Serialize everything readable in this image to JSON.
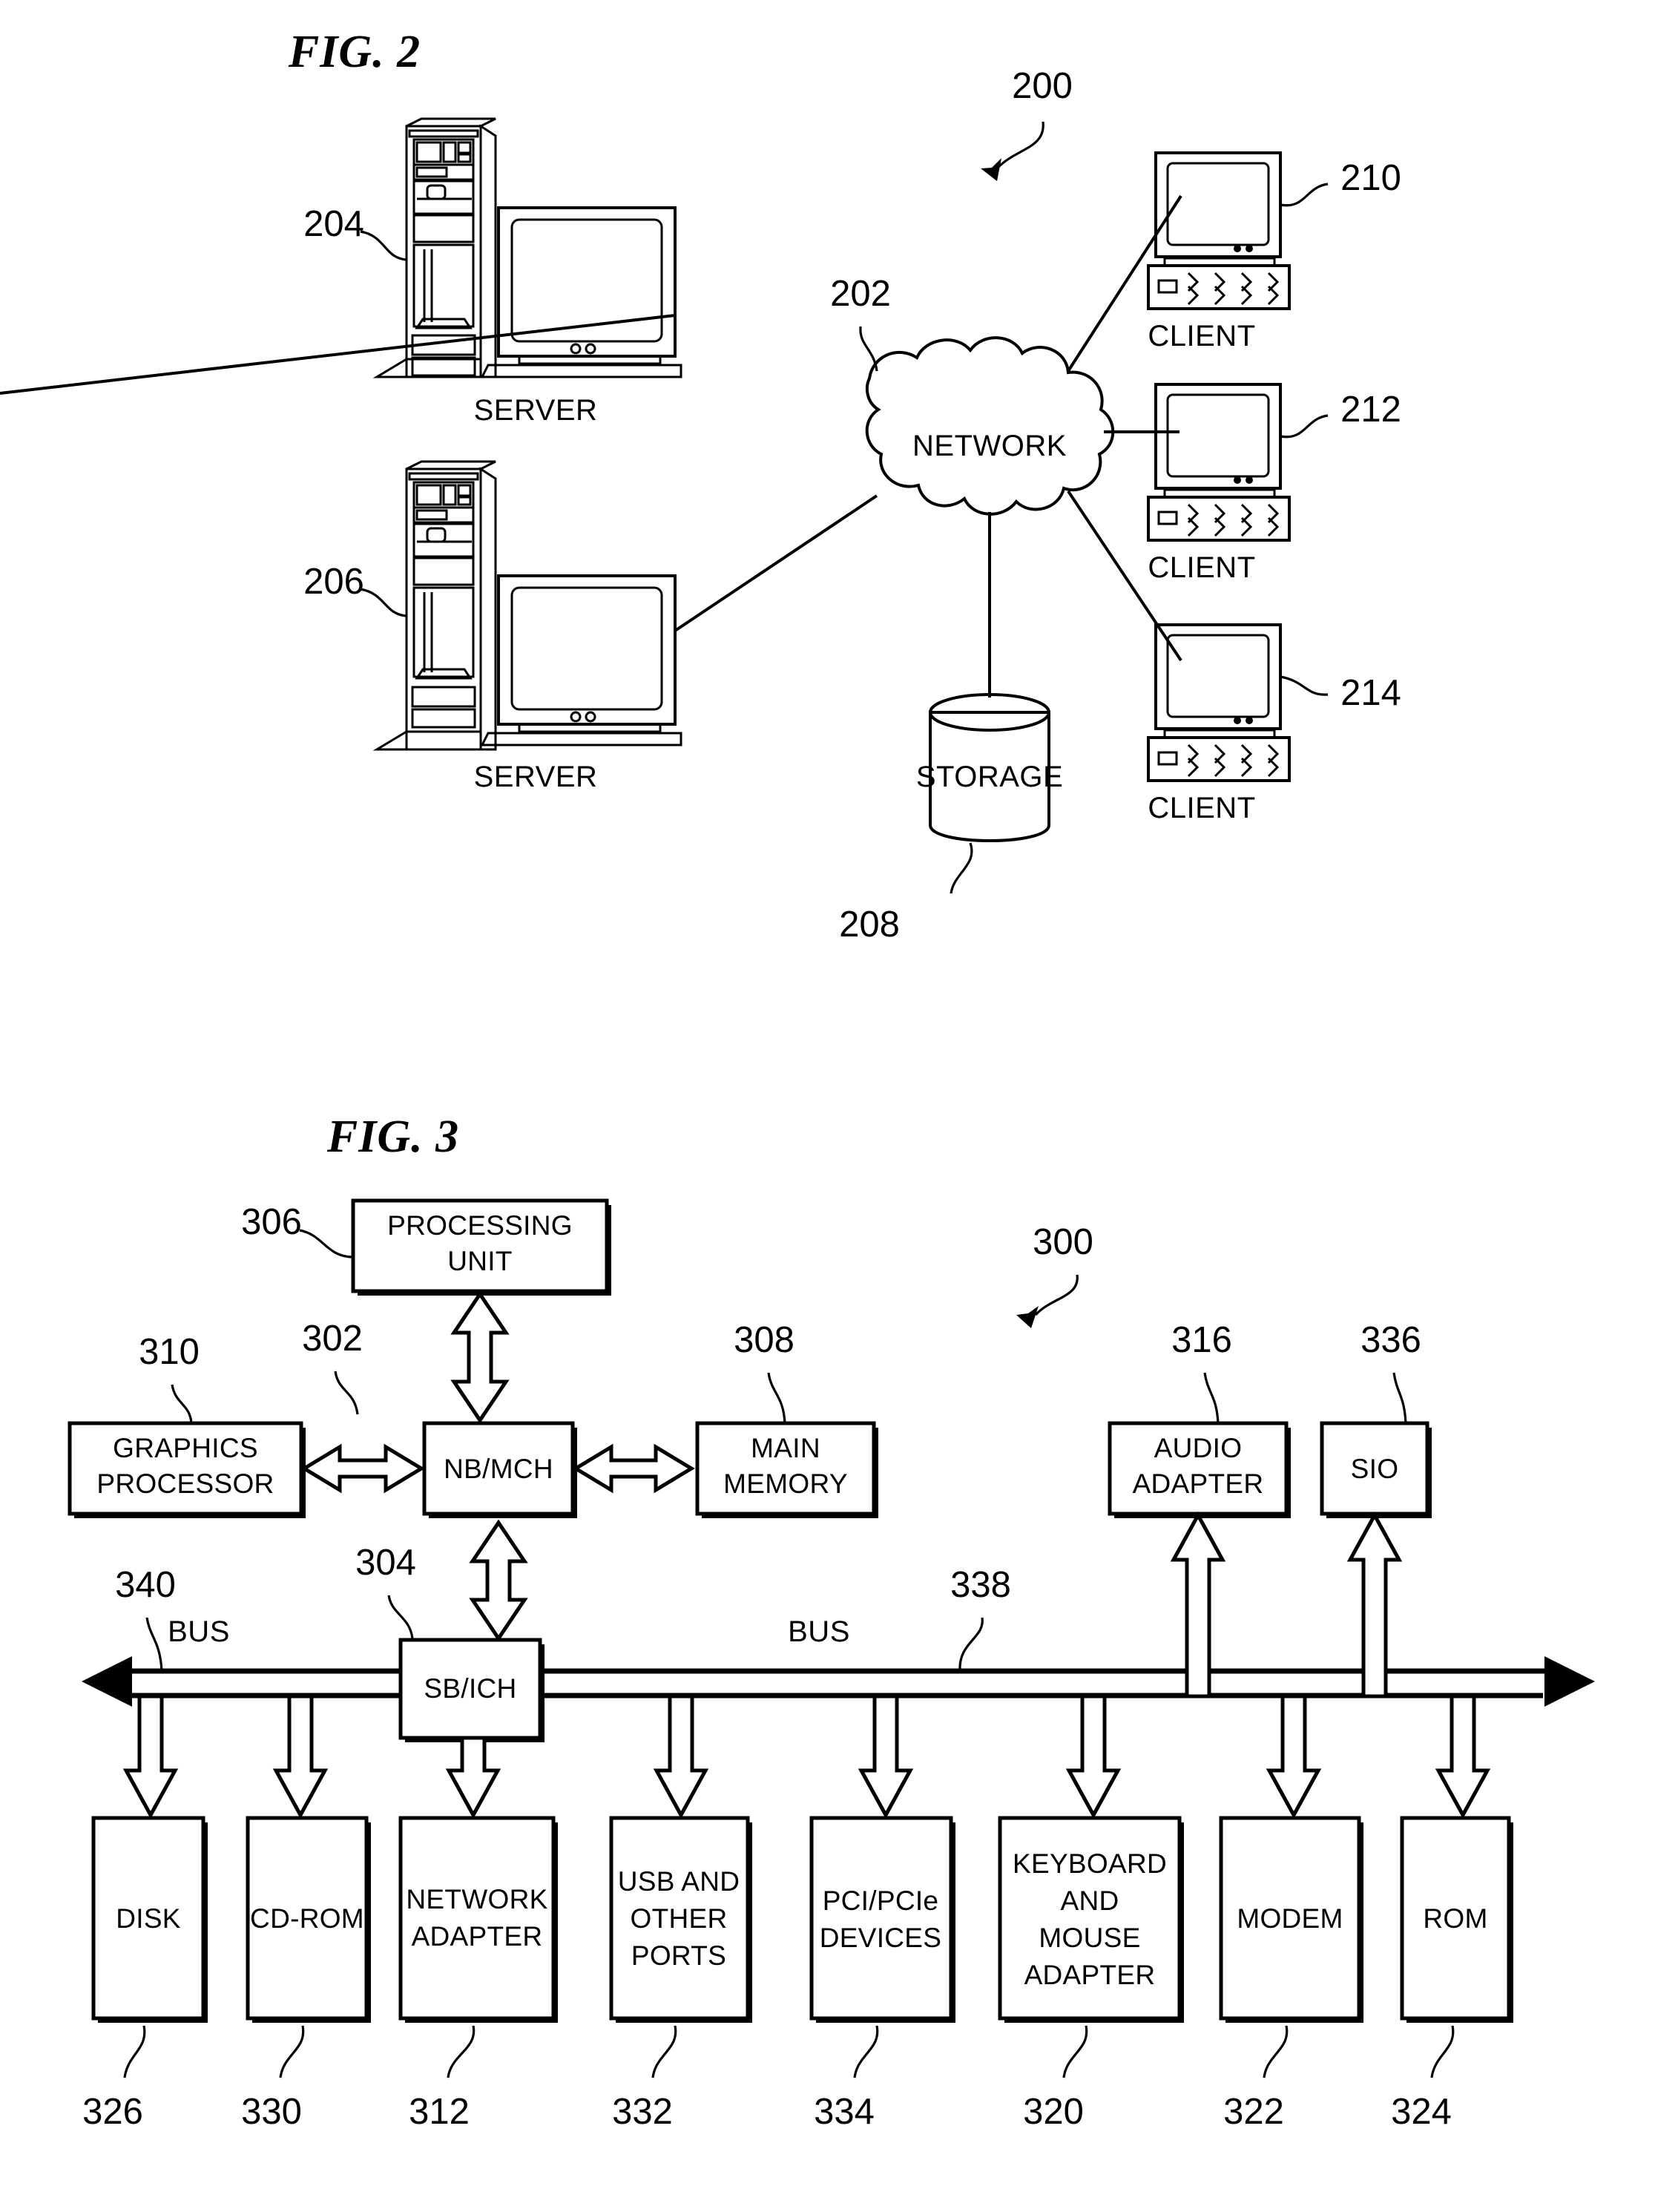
{
  "figures": [
    {
      "id": "fig2",
      "title": "FIG. 2",
      "system_ref": "200",
      "nodes": {
        "network": {
          "label": "NETWORK",
          "ref": "202"
        },
        "server_top": {
          "label": "SERVER",
          "ref": "204"
        },
        "server_bottom": {
          "label": "SERVER",
          "ref": "206"
        },
        "storage": {
          "label": "STORAGE",
          "ref": "208"
        },
        "client_top": {
          "label": "CLIENT",
          "ref": "210"
        },
        "client_mid": {
          "label": "CLIENT",
          "ref": "212"
        },
        "client_bottom": {
          "label": "CLIENT",
          "ref": "214"
        }
      }
    },
    {
      "id": "fig3",
      "title": "FIG. 3",
      "system_ref": "300",
      "boxes": {
        "processing_unit": {
          "label_line1": "PROCESSING",
          "label_line2": "UNIT",
          "ref": "306"
        },
        "graphics_processor": {
          "label_line1": "GRAPHICS",
          "label_line2": "PROCESSOR",
          "ref": "310"
        },
        "nb_mch": {
          "label_line1": "NB/MCH",
          "ref": "302"
        },
        "main_memory": {
          "label_line1": "MAIN",
          "label_line2": "MEMORY",
          "ref": "308"
        },
        "audio_adapter": {
          "label_line1": "AUDIO",
          "label_line2": "ADAPTER",
          "ref": "316"
        },
        "sio": {
          "label_line1": "SIO",
          "ref": "336"
        },
        "sb_ich": {
          "label_line1": "SB/ICH",
          "ref": "304"
        },
        "disk": {
          "label_line1": "DISK",
          "ref": "326"
        },
        "cdrom": {
          "label_line1": "CD-ROM",
          "ref": "330"
        },
        "network_adapter": {
          "label_line1": "NETWORK",
          "label_line2": "ADAPTER",
          "ref": "312"
        },
        "usb_ports": {
          "label_line1": "USB AND",
          "label_line2": "OTHER",
          "label_line3": "PORTS",
          "ref": "332"
        },
        "pci_devices": {
          "label_line1": "PCI/PCIe",
          "label_line2": "DEVICES",
          "ref": "334"
        },
        "keyboard_mouse": {
          "label_line1": "KEYBOARD",
          "label_line2": "AND",
          "label_line3": "MOUSE",
          "label_line4": "ADAPTER",
          "ref": "320"
        },
        "modem": {
          "label_line1": "MODEM",
          "ref": "322"
        },
        "rom": {
          "label_line1": "ROM",
          "ref": "324"
        }
      },
      "buses": {
        "left": {
          "label": "BUS",
          "ref": "340"
        },
        "right": {
          "label": "BUS",
          "ref": "338"
        }
      }
    }
  ],
  "colors": {
    "ink": "#000000",
    "paper": "#ffffff"
  }
}
